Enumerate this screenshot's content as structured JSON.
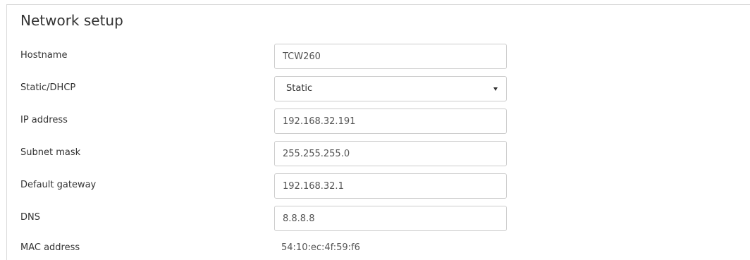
{
  "section": {
    "title": "Network setup"
  },
  "fields": {
    "hostname": {
      "label": "Hostname",
      "value": "TCW260"
    },
    "static_dhcp": {
      "label": "Static/DHCP",
      "value": "Static"
    },
    "ip_address": {
      "label": "IP address",
      "value": "192.168.32.191"
    },
    "subnet_mask": {
      "label": "Subnet mask",
      "value": "255.255.255.0"
    },
    "default_gateway": {
      "label": "Default gateway",
      "value": "192.168.32.1"
    },
    "dns": {
      "label": "DNS",
      "value": "8.8.8.8"
    },
    "mac_address": {
      "label": "MAC address",
      "value": "54:10:ec:4f:59:f6"
    }
  },
  "icons": {
    "select_caret": "chevron-down-icon"
  }
}
